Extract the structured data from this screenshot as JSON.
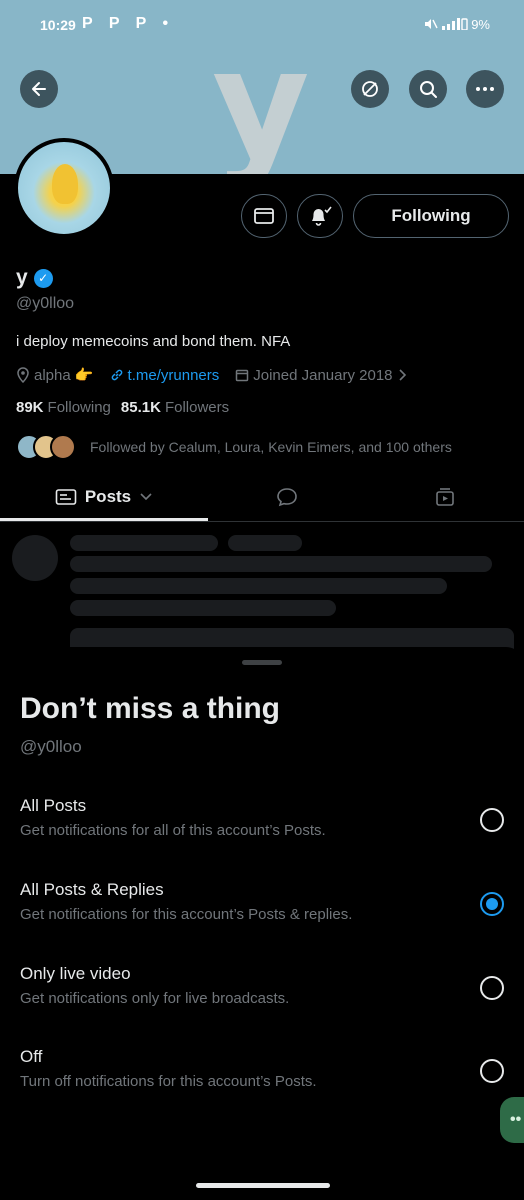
{
  "status_bar": {
    "time": "10:29",
    "app_icons": "P P P •",
    "battery": "9%"
  },
  "banner": {
    "letter": "y"
  },
  "profile": {
    "name": "y",
    "handle": "@y0lloo",
    "bio": "i deploy memecoins and bond them. NFA",
    "location": "alpha 👉",
    "website": "t.me/yrunners",
    "joined": "Joined January 2018",
    "following_count": "89K",
    "following_label": "Following",
    "followers_count": "85.1K",
    "followers_label": "Followers",
    "followed_by": "Followed by Cealum, Loura, Kevin Eimers, and 100 others"
  },
  "actions": {
    "following_button": "Following"
  },
  "tabs": {
    "posts_label": "Posts"
  },
  "sheet": {
    "title": "Don’t miss a thing",
    "handle": "@y0lloo",
    "options": [
      {
        "title": "All Posts",
        "desc": "Get notifications for all of this account’s Posts.",
        "selected": false
      },
      {
        "title": "All Posts & Replies",
        "desc": "Get notifications for this account’s Posts & replies.",
        "selected": true
      },
      {
        "title": "Only live video",
        "desc": "Get notifications only for live broadcasts.",
        "selected": false
      },
      {
        "title": "Off",
        "desc": "Turn off notifications for this account’s Posts.",
        "selected": false
      }
    ]
  },
  "colors": {
    "accent": "#1d9bf0",
    "banner": "#88b6c8",
    "background": "#000000",
    "muted_text": "#71767b"
  },
  "icons": [
    "back-arrow-icon",
    "eye-off-icon",
    "search-icon",
    "more-icon",
    "mail-icon",
    "bell-check-icon",
    "location-icon",
    "link-icon",
    "calendar-icon",
    "chevron-right-icon",
    "posts-icon",
    "chevron-down-icon",
    "reply-icon",
    "media-icon"
  ]
}
